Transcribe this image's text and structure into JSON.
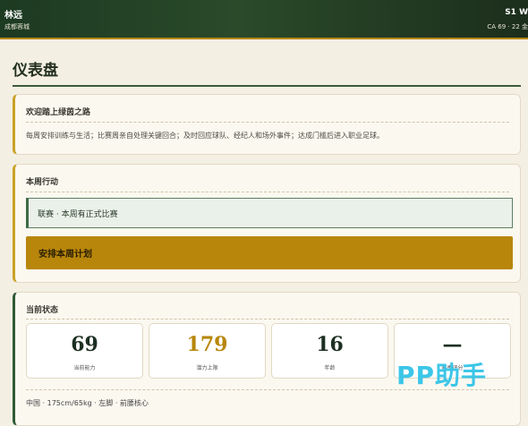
{
  "topbar": {
    "player_name": "林远",
    "club_sub": "成都蓉城",
    "season": "S1 W",
    "ca_date": "CA 69 · 22 金"
  },
  "page": {
    "title": "仪表盘"
  },
  "welcome": {
    "title": "欢迎踏上绿茵之路",
    "text": "每周安排训练与生活；比赛周亲自处理关键回合；及时回应球队、经纪人和场外事件；达成门槛后进入职业足球。"
  },
  "week_actions": {
    "title": "本周行动",
    "notice": "联赛 · 本周有正式比赛",
    "plan_button": "安排本周计划"
  },
  "status": {
    "title": "当前状态",
    "stats": [
      {
        "value": "69",
        "label": "当前能力",
        "color": "#1d2f22"
      },
      {
        "value": "179",
        "label": "潜力上限",
        "color": "#b8860b"
      },
      {
        "value": "16",
        "label": "年龄",
        "color": "#1d2f22"
      },
      {
        "value": "—",
        "label": "赛季评分",
        "color": "#1d2f22"
      }
    ],
    "bio": "中国 · 175cm/65kg · 左脚 · 前腰核心"
  },
  "watermark": "PP助手"
}
